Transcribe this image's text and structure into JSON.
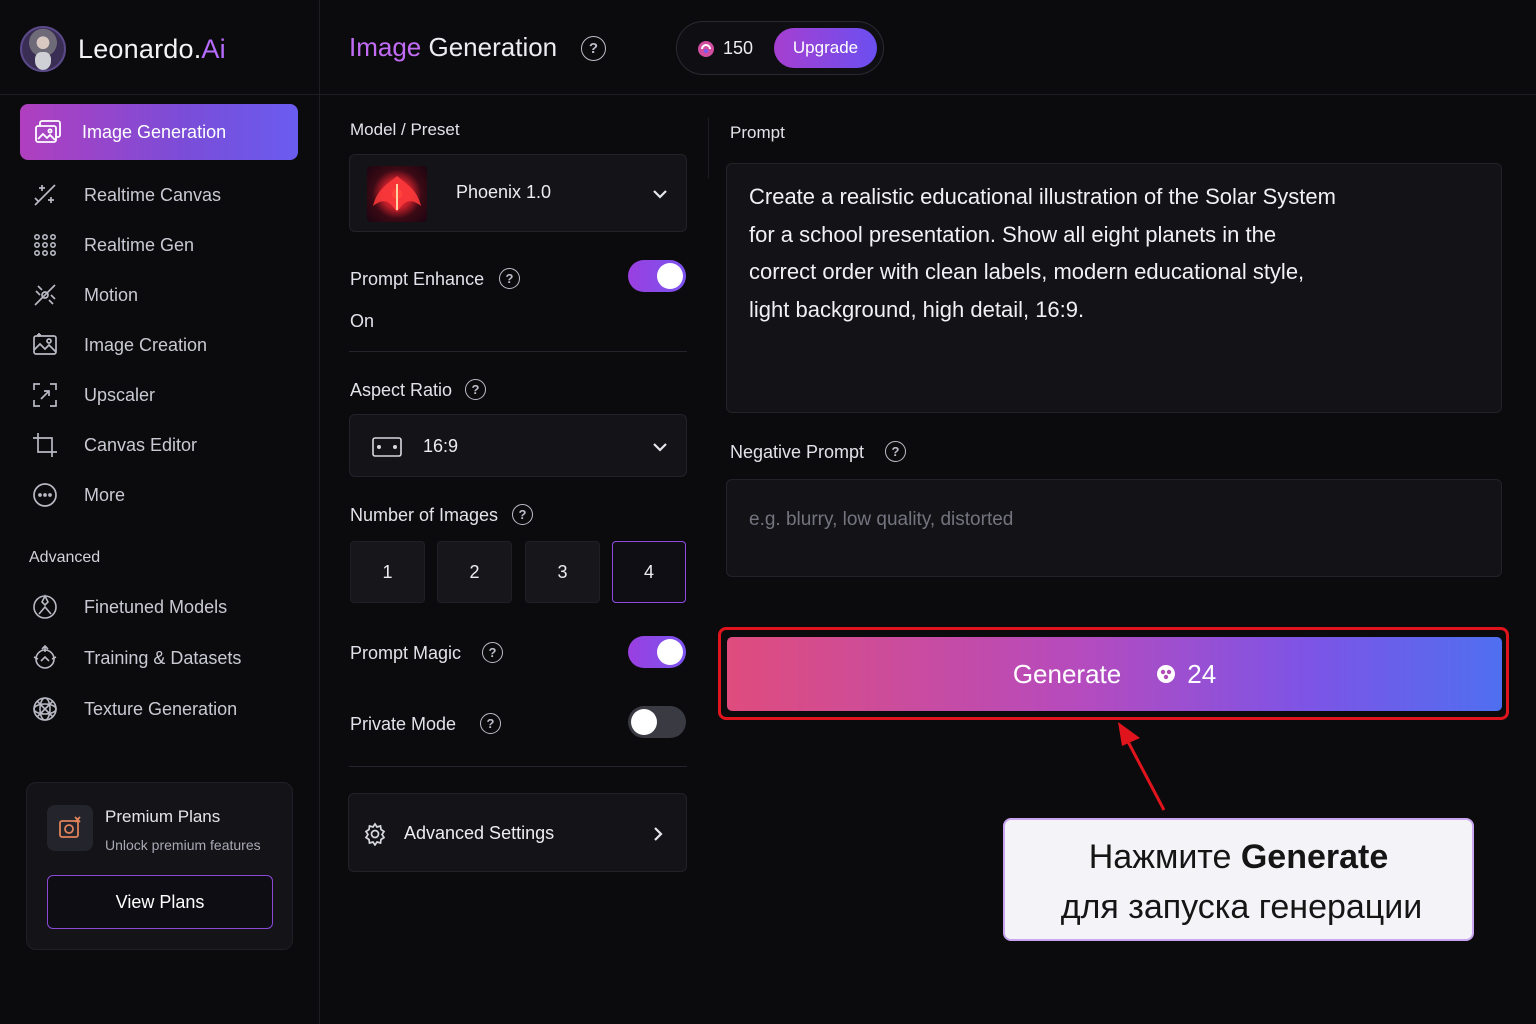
{
  "app": {
    "brand_name": "Leonardo.",
    "brand_suffix": "Ai"
  },
  "sidebar": {
    "active_item": "Image Generation",
    "items": [
      {
        "label": "Realtime Canvas",
        "icon": "brush-icon"
      },
      {
        "label": "Realtime Gen",
        "icon": "grid-dots-icon"
      },
      {
        "label": "Motion",
        "icon": "motion-icon"
      },
      {
        "label": "Image Creation",
        "icon": "image-icon"
      },
      {
        "label": "Upscaler",
        "icon": "upscale-icon"
      },
      {
        "label": "Canvas Editor",
        "icon": "crop-icon"
      },
      {
        "label": "More",
        "icon": "more-icon"
      }
    ],
    "section_label": "Advanced",
    "advanced_items": [
      {
        "label": "Finetuned Models",
        "icon": "finetune-icon"
      },
      {
        "label": "Training & Datasets",
        "icon": "training-icon"
      },
      {
        "label": "Texture Generation",
        "icon": "texture-icon"
      }
    ],
    "premium": {
      "title": "Premium Plans",
      "subtitle": "Unlock premium features",
      "button": "View Plans"
    }
  },
  "header": {
    "title_part1": "Image",
    "title_part2": "Generation",
    "credits": "150",
    "upgrade": "Upgrade"
  },
  "settings": {
    "model_label": "Model / Preset",
    "model_name": "Phoenix 1.0",
    "prompt_enhance_label": "Prompt Enhance",
    "prompt_enhance_on": true,
    "prompt_enhance_status": "On",
    "aspect_ratio_label": "Aspect Ratio",
    "aspect_ratio_value": "16:9",
    "num_images_label": "Number of Images",
    "num_images_options": [
      "1",
      "2",
      "3",
      "4"
    ],
    "num_images_selected": "4",
    "prompt_magic_label": "Prompt Magic",
    "prompt_magic_on": true,
    "private_mode_label": "Private Mode",
    "private_mode_on": false,
    "advanced_settings_label": "Advanced Settings"
  },
  "prompt": {
    "label": "Prompt",
    "lines": [
      "Create a realistic educational illustration of the Solar System",
      "for a school presentation. Show all eight planets in the",
      "correct order with clean labels, modern educational style,",
      "light background, high detail, 16:9."
    ],
    "negative_label": "Negative Prompt",
    "negative_placeholder": "e.g. blurry, low quality, distorted",
    "negative_value": ""
  },
  "generate": {
    "label": "Generate",
    "cost": "24"
  },
  "callout": {
    "line1_prefix": "Нажмите ",
    "line1_bold": "Generate",
    "line2": "для запуска генерации"
  },
  "colors": {
    "accent_purple": "#8f4be0",
    "highlight_red": "#e0141c",
    "background": "#0b0b0e"
  }
}
